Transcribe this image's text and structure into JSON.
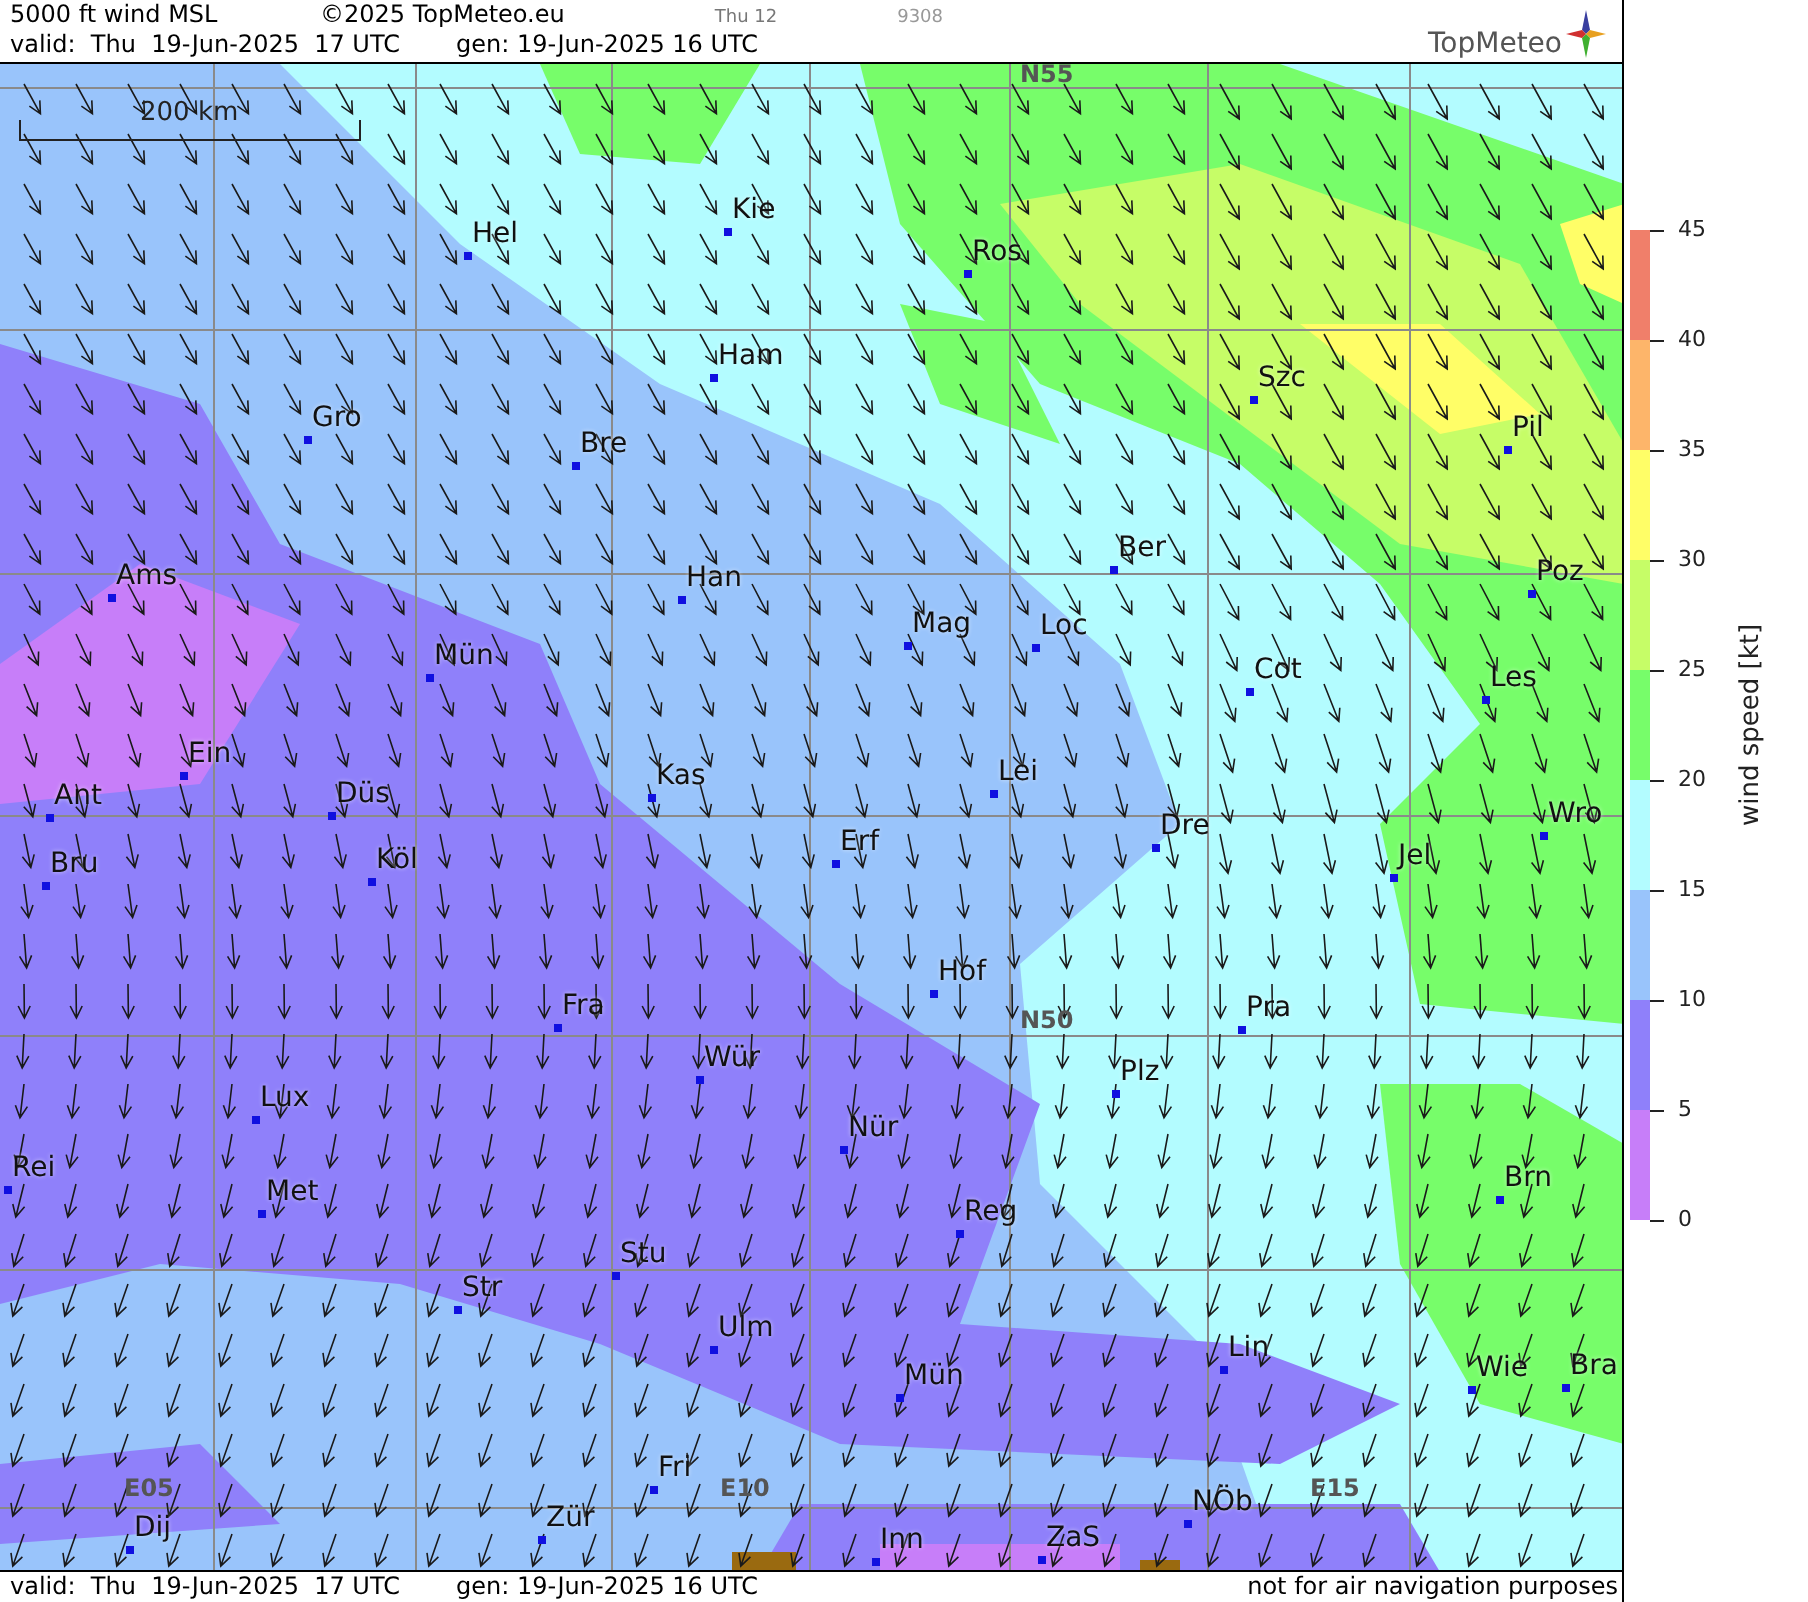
{
  "header": {
    "title": "5000 ft wind MSL",
    "copyright": "©2025 TopMeteo.eu",
    "run_day": "Thu 12",
    "code": "9308",
    "valid": "valid:  Thu  19-Jun-2025  17 UTC",
    "generated": "gen: 19-Jun-2025 16 UTC",
    "logo": "TopMeteo"
  },
  "map": {
    "scale_bar": "200 km",
    "grid_labels": [
      "N55",
      "N50",
      "E05",
      "E10",
      "E15"
    ],
    "cities": [
      "Hel",
      "Kie",
      "Ros",
      "Ham",
      "Gro",
      "Bre",
      "Szc",
      "Pil",
      "Ber",
      "Ams",
      "Han",
      "Poz",
      "Mag",
      "Loc",
      "Mün",
      "Cot",
      "Les",
      "Ein",
      "Ant",
      "Düs",
      "Kas",
      "Lei",
      "Wro",
      "Bru",
      "Köl",
      "Erf",
      "Dre",
      "Jel",
      "Hof",
      "Fra",
      "Pra",
      "Wür",
      "Plz",
      "Lux",
      "Nür",
      "Rei",
      "Met",
      "Brn",
      "Reg",
      "Stu",
      "Str",
      "Ulm",
      "Lin",
      "Wie",
      "Bra",
      "Mün",
      "Fri",
      "NÖb",
      "Dij",
      "Zür",
      "Inn",
      "ZaS"
    ]
  },
  "legend": {
    "title": "wind speed [kt]",
    "bands": [
      {
        "color": "#f07f6a"
      },
      {
        "color": "#fdb56a"
      },
      {
        "color": "#fffe67"
      },
      {
        "color": "#c6fd67"
      },
      {
        "color": "#77fd6a"
      },
      {
        "color": "#b3fcff"
      },
      {
        "color": "#99c4fb"
      },
      {
        "color": "#8f80fa"
      },
      {
        "color": "#c77ef9"
      }
    ],
    "ticks": [
      "45",
      "40",
      "35",
      "30",
      "25",
      "20",
      "15",
      "10",
      "5",
      "0"
    ]
  },
  "footer": {
    "valid": "valid:  Thu  19-Jun-2025  17 UTC",
    "generated": "gen: 19-Jun-2025 16 UTC",
    "disclaimer": "not for air navigation purposes"
  }
}
